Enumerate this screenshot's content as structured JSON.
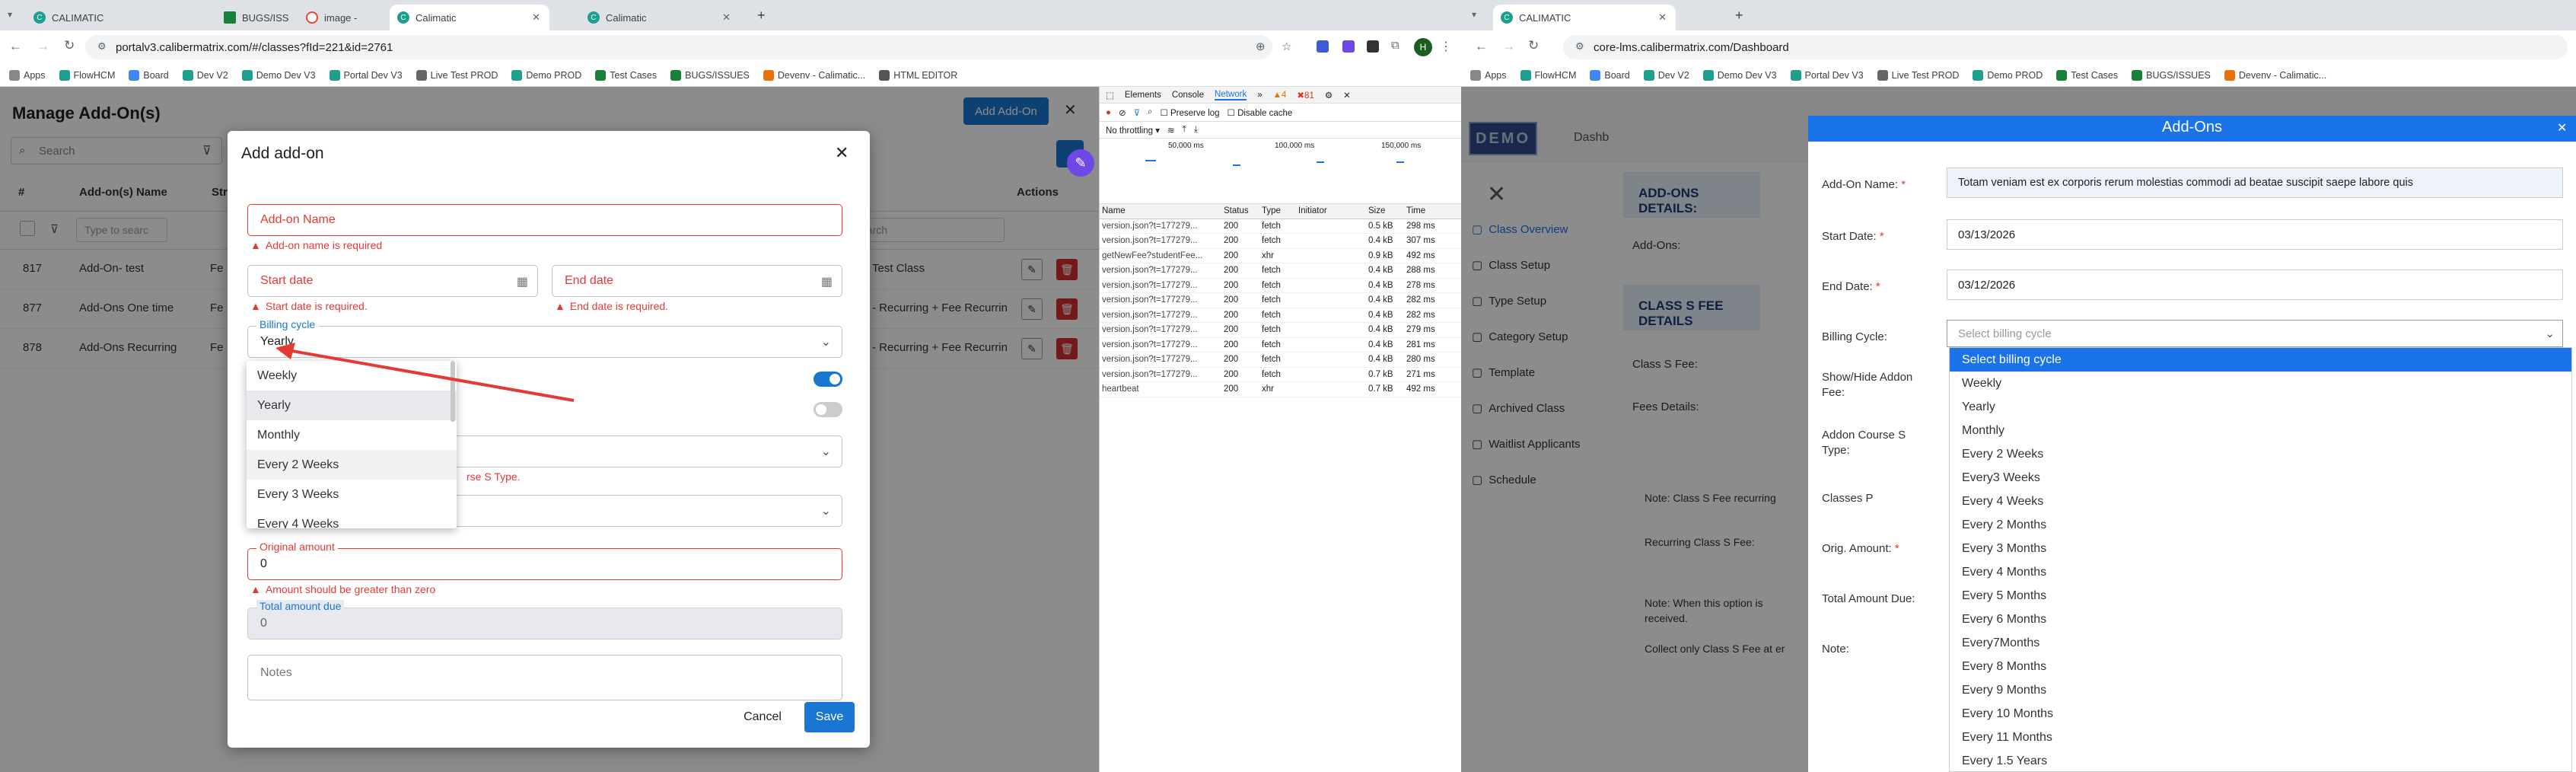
{
  "left_browser": {
    "tabs": [
      {
        "label": "CALIMATIC",
        "active": false
      },
      {
        "label": "BUGS/ISS",
        "active": false
      },
      {
        "label": "image -",
        "active": false
      },
      {
        "label": "Calimatic",
        "active": true
      },
      {
        "label": "Calimatic",
        "active": false
      }
    ],
    "url": "portalv3.calibermatrix.com/#/classes?fId=221&id=2761",
    "avatar": "H",
    "bookmarks": [
      "Apps",
      "FlowHCM",
      "Board",
      "Dev V2",
      "Demo Dev V3",
      "Portal Dev V3",
      "Live Test PROD",
      "Demo PROD",
      "Test Cases",
      "BUGS/ISSUES",
      "Devenv - Calimatic...",
      "HTML EDITOR"
    ]
  },
  "page": {
    "title": "Manage Add-On(s)",
    "add_button": "Add Add-On",
    "search_placeholder": "Search",
    "columns": [
      "#",
      "Add-on(s) Name",
      "Str",
      "Actions"
    ],
    "filter_placeholder": "Type to searc",
    "right_filter_placeholder": "earch",
    "rows": [
      {
        "id": "817",
        "name": "Add-On- test",
        "c3": "Fe",
        "c4": "Test Class"
      },
      {
        "id": "877",
        "name": "Add-Ons One time",
        "c3": "Fe",
        "c4": "- Recurring + Fee Recurrin"
      },
      {
        "id": "878",
        "name": "Add-Ons Recurring",
        "c3": "Fe",
        "c4": "- Recurring + Fee Recurrin"
      }
    ]
  },
  "modal": {
    "title": "Add add-on",
    "addon_name_placeholder": "Add-on Name",
    "addon_name_error": "Add-on name is required",
    "start_date_placeholder": "Start date",
    "start_date_error": "Start date is required.",
    "end_date_placeholder": "End date",
    "end_date_error": "End date is required.",
    "billing_label": "Billing cycle",
    "billing_value": "Yearly",
    "billing_options": [
      "Weekly",
      "Yearly",
      "Monthly",
      "Every 2 Weeks",
      "Every 3 Weeks",
      "Every 4 Weeks"
    ],
    "course_type_error": "rse S Type.",
    "original_amount_label": "Original amount",
    "original_amount_value": "0",
    "original_amount_error": "Amount should be greater than zero",
    "total_due_label": "Total amount due",
    "total_due_value": "0",
    "notes_placeholder": "Notes",
    "cancel": "Cancel",
    "save": "Save"
  },
  "devtools": {
    "tabs": [
      "Elements",
      "Console",
      "Network"
    ],
    "warn_count": "4",
    "err_count": "81",
    "preserve_log": "Preserve log",
    "disable_cache": "Disable cache",
    "throttling": "No throttling",
    "timeline_ticks": [
      "50,000 ms",
      "100,000 ms",
      "150,000 ms"
    ],
    "columns": [
      "Name",
      "Status",
      "Type",
      "Initiator",
      "Size",
      "Time"
    ],
    "rows": [
      [
        "version.json?t=177279...",
        "200",
        "fetch",
        "",
        "0.5 kB",
        "298 ms"
      ],
      [
        "version.json?t=177279...",
        "200",
        "fetch",
        "",
        "0.4 kB",
        "307 ms"
      ],
      [
        "getNewFee?studentFee...",
        "200",
        "xhr",
        "",
        "0.9 kB",
        "492 ms"
      ],
      [
        "version.json?t=177279...",
        "200",
        "fetch",
        "",
        "0.4 kB",
        "288 ms"
      ],
      [
        "version.json?t=177279...",
        "200",
        "fetch",
        "",
        "0.4 kB",
        "278 ms"
      ],
      [
        "version.json?t=177279...",
        "200",
        "fetch",
        "",
        "0.4 kB",
        "282 ms"
      ],
      [
        "version.json?t=177279...",
        "200",
        "fetch",
        "",
        "0.4 kB",
        "282 ms"
      ],
      [
        "version.json?t=177279...",
        "200",
        "fetch",
        "",
        "0.4 kB",
        "279 ms"
      ],
      [
        "version.json?t=177279...",
        "200",
        "fetch",
        "",
        "0.4 kB",
        "281 ms"
      ],
      [
        "version.json?t=177279...",
        "200",
        "fetch",
        "",
        "0.4 kB",
        "280 ms"
      ],
      [
        "version.json?t=177279...",
        "200",
        "fetch",
        "",
        "0.7 kB",
        "271 ms"
      ],
      [
        "heartbeat",
        "200",
        "xhr",
        "",
        "0.7 kB",
        "492 ms"
      ]
    ]
  },
  "right_browser": {
    "tab": "CALIMATIC",
    "url": "core-lms.calibermatrix.com/Dashboard",
    "bookmarks": [
      "Apps",
      "FlowHCM",
      "Board",
      "Dev V2",
      "Demo Dev V3",
      "Portal Dev V3",
      "Live Test PROD",
      "Demo PROD",
      "Test Cases",
      "BUGS/ISSUES",
      "Devenv - Calimatic..."
    ],
    "logo": "DEMO",
    "dash": "Dashb",
    "sidebar": [
      "Class Overview",
      "Class Setup",
      "Type Setup",
      "Category Setup",
      "Template",
      "Archived Class",
      "Waitlist Applicants",
      "Schedule"
    ],
    "bg_headers": [
      "ADD-ONS DETAILS:",
      "CLASS S FEE DETAILS"
    ],
    "bg_labels": [
      "Add-Ons:",
      "Class S Fee:",
      "Fees Details:"
    ],
    "bg_notes": [
      "Note: Class S Fee recurring",
      "Recurring Class S Fee:",
      "Note: When this option is",
      "received.",
      "Collect only Class S Fee at er"
    ],
    "panel_title": "Add-Ons",
    "addon_name_label": "Add-On Name:",
    "addon_name_value": "Totam veniam est ex corporis rerum molestias commodi ad beatae suscipit saepe labore quis",
    "start_label": "Start Date:",
    "start_value": "03/13/2026",
    "end_label": "End Date:",
    "end_value": "03/12/2026",
    "billing_label": "Billing Cycle:",
    "billing_placeholder": "Select billing cycle",
    "show_hide_label": "Show/Hide Addon Fee:",
    "course_type_label": "Addon Course S Type:",
    "classes_label": "Classes P",
    "orig_label": "Orig. Amount:",
    "total_label": "Total Amount Due:",
    "note_label": "Note:",
    "billing_options": [
      "Select billing cycle",
      "Weekly",
      "Yearly",
      "Monthly",
      "Every 2 Weeks",
      "Every3 Weeks",
      "Every 4 Weeks",
      "Every 2 Months",
      "Every 3 Months",
      "Every 4 Months",
      "Every 5 Months",
      "Every 6 Months",
      "Every7Months",
      "Every 8 Months",
      "Every 9 Months",
      "Every 10 Months",
      "Every 11 Months",
      "Every 1.5 Years"
    ]
  },
  "colors": {
    "primary": "#1976d2",
    "error": "#e53935",
    "danger": "#d32f2f",
    "highlight": "#1a73e8"
  }
}
